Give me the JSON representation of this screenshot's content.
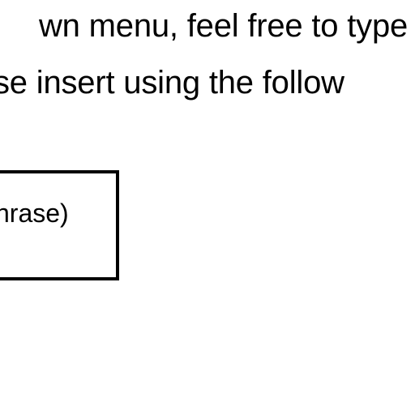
{
  "document": {
    "lines": [
      "wn menu, feel free to type",
      "se insert using the follow"
    ],
    "input_box": {
      "text": "hrase)"
    }
  }
}
